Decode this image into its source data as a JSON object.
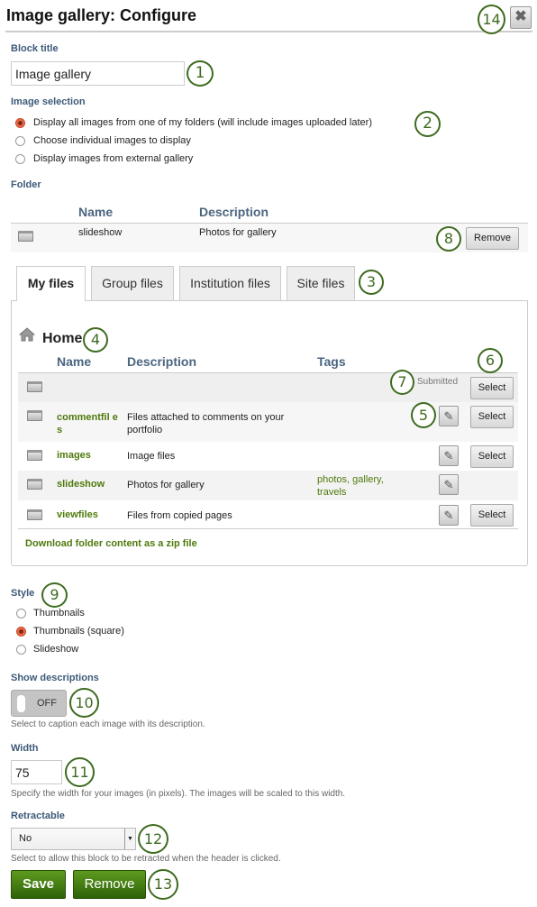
{
  "header": {
    "title": "Image gallery: Configure",
    "close_icon": "close-x-icon"
  },
  "block_title": {
    "label": "Block title",
    "value": "Image gallery"
  },
  "image_selection": {
    "label": "Image selection",
    "options": [
      {
        "label": "Display all images from one of my folders (will include images uploaded later)",
        "selected": true
      },
      {
        "label": "Choose individual images to display",
        "selected": false
      },
      {
        "label": "Display images from external gallery",
        "selected": false
      }
    ]
  },
  "folder": {
    "label": "Folder",
    "headers": {
      "name": "Name",
      "description": "Description"
    },
    "row": {
      "name": "slideshow",
      "description": "Photos for gallery",
      "remove_label": "Remove"
    }
  },
  "tabs": [
    {
      "label": "My files",
      "active": true
    },
    {
      "label": "Group files"
    },
    {
      "label": "Institution files"
    },
    {
      "label": "Site files"
    }
  ],
  "browser": {
    "home": "Home",
    "headers": {
      "name": "Name",
      "description": "Description",
      "tags": "Tags"
    },
    "submitted": "Submitted",
    "select_label": "Select",
    "rows": [
      {
        "name": "",
        "description": "",
        "tags": ""
      },
      {
        "name": "commentfil es",
        "description": "Files attached to comments on your portfolio",
        "tags": ""
      },
      {
        "name": "images",
        "description": "Image files",
        "tags": ""
      },
      {
        "name": "slideshow",
        "description": "Photos for gallery",
        "tags": "photos, gallery, travels"
      },
      {
        "name": "viewfiles",
        "description": "Files from copied pages",
        "tags": ""
      }
    ],
    "download_link": "Download folder content as a zip file"
  },
  "style": {
    "label": "Style",
    "options": [
      {
        "label": "Thumbnails",
        "selected": false
      },
      {
        "label": "Thumbnails (square)",
        "selected": true
      },
      {
        "label": "Slideshow",
        "selected": false
      }
    ]
  },
  "show_descriptions": {
    "label": "Show descriptions",
    "toggle": "OFF",
    "help": "Select to caption each image with its description."
  },
  "width": {
    "label": "Width",
    "value": "75",
    "help": "Specify the width for your images (in pixels). The images will be scaled to this width."
  },
  "retractable": {
    "label": "Retractable",
    "value": "No",
    "help": "Select to allow this block to be retracted when the header is clicked."
  },
  "actions": {
    "save": "Save",
    "remove": "Remove"
  },
  "callouts": [
    "1",
    "2",
    "3",
    "4",
    "5",
    "6",
    "7",
    "8",
    "9",
    "10",
    "11",
    "12",
    "13",
    "14"
  ],
  "colors": {
    "accent": "#3e6b1f",
    "link": "#4f7a0c",
    "label": "#3d5a78"
  }
}
